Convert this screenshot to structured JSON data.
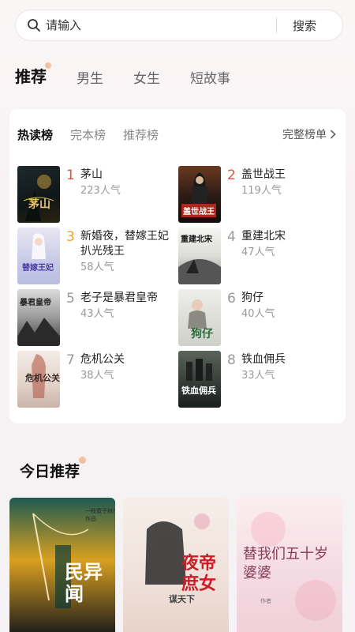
{
  "search": {
    "placeholder": "请输入",
    "button_label": "搜索"
  },
  "top_tabs": [
    {
      "label": "推荐",
      "active": true
    },
    {
      "label": "男生",
      "active": false
    },
    {
      "label": "女生",
      "active": false
    },
    {
      "label": "短故事",
      "active": false
    }
  ],
  "ranking": {
    "tabs": [
      {
        "label": "热读榜",
        "active": true
      },
      {
        "label": "完本榜",
        "active": false
      },
      {
        "label": "推荐榜",
        "active": false
      }
    ],
    "full_list_label": "完整榜单",
    "items": [
      {
        "rank": "1",
        "title": "茅山",
        "popularity": "223人气",
        "cover_text": "茅山"
      },
      {
        "rank": "2",
        "title": "盖世战王",
        "popularity": "119人气",
        "cover_text": "盖世战王"
      },
      {
        "rank": "3",
        "title": "新婚夜，替嫁王妃扒光残王",
        "popularity": "58人气",
        "cover_text": "替嫁王妃"
      },
      {
        "rank": "4",
        "title": "重建北宋",
        "popularity": "47人气",
        "cover_text": "重建北宋"
      },
      {
        "rank": "5",
        "title": "老子是暴君皇帝",
        "popularity": "43人气",
        "cover_text": "暴君皇帝"
      },
      {
        "rank": "6",
        "title": "狗仔",
        "popularity": "40人气",
        "cover_text": "狗仔"
      },
      {
        "rank": "7",
        "title": "危机公关",
        "popularity": "38人气",
        "cover_text": "危机公关"
      },
      {
        "rank": "8",
        "title": "铁血佣兵",
        "popularity": "33人气",
        "cover_text": "铁血佣兵"
      }
    ]
  },
  "today": {
    "header": "今日推荐",
    "books": [
      {
        "cover_text": "民异闻",
        "author_line": "一枝霓子树/作品"
      },
      {
        "cover_text": "夜帝庶女",
        "sub_text": "谋天下"
      },
      {
        "cover_text": "替我们五十岁婆婆",
        "author_line": "作者"
      }
    ]
  },
  "colors": {
    "rank_hot": "#e0523a",
    "rank_warm": "#f0a028",
    "rank_plain": "#999999",
    "accent_dot": "#f3b48a"
  }
}
